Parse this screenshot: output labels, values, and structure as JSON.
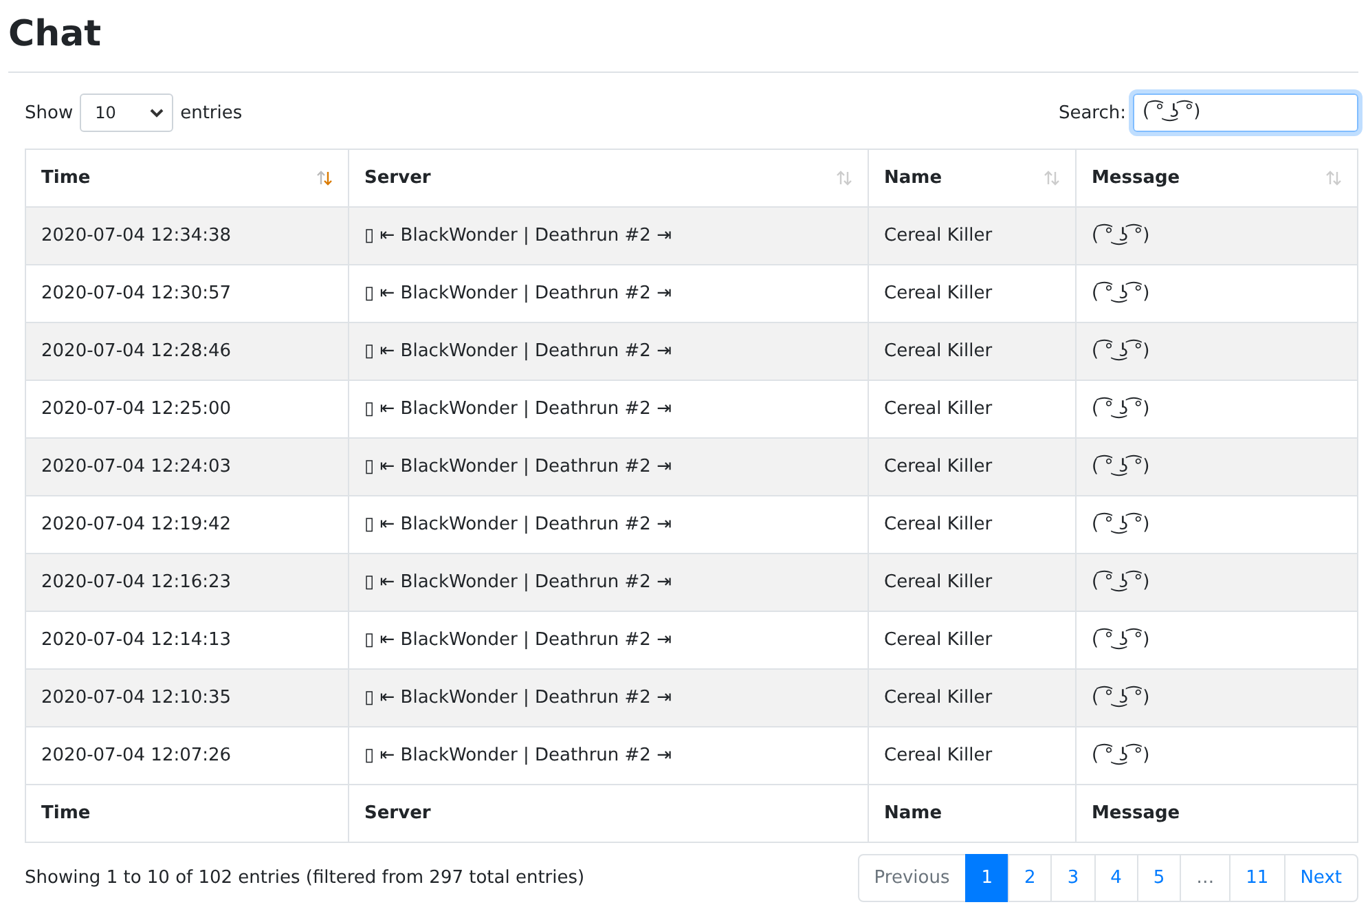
{
  "page": {
    "title": "Chat"
  },
  "length_control": {
    "prefix": "Show",
    "value": "10",
    "suffix": "entries"
  },
  "search": {
    "label": "Search:",
    "value": "( ͡° ͜ʖ ͡°)"
  },
  "table": {
    "columns": [
      {
        "label": "Time",
        "sorted": true
      },
      {
        "label": "Server",
        "sorted": false
      },
      {
        "label": "Name",
        "sorted": false
      },
      {
        "label": "Message",
        "sorted": false
      }
    ],
    "rows": [
      [
        "2020-07-04 12:34:38",
        "▯ ⇤ BlackWonder | Deathrun #2 ⇥",
        "Cereal Killer",
        "( ͡° ͜ʖ ͡°)"
      ],
      [
        "2020-07-04 12:30:57",
        "▯ ⇤ BlackWonder | Deathrun #2 ⇥",
        "Cereal Killer",
        "( ͡° ͜ʖ ͡°)"
      ],
      [
        "2020-07-04 12:28:46",
        "▯ ⇤ BlackWonder | Deathrun #2 ⇥",
        "Cereal Killer",
        "( ͡° ͜ʖ ͡°)"
      ],
      [
        "2020-07-04 12:25:00",
        "▯ ⇤ BlackWonder | Deathrun #2 ⇥",
        "Cereal Killer",
        "( ͡° ͜ʖ ͡°)"
      ],
      [
        "2020-07-04 12:24:03",
        "▯ ⇤ BlackWonder | Deathrun #2 ⇥",
        "Cereal Killer",
        "( ͡° ͜ʖ ͡°)"
      ],
      [
        "2020-07-04 12:19:42",
        "▯ ⇤ BlackWonder | Deathrun #2 ⇥",
        "Cereal Killer",
        "( ͡° ͜ʖ ͡°)"
      ],
      [
        "2020-07-04 12:16:23",
        "▯ ⇤ BlackWonder | Deathrun #2 ⇥",
        "Cereal Killer",
        "( ͡° ͜ʖ ͡°)"
      ],
      [
        "2020-07-04 12:14:13",
        "▯ ⇤ BlackWonder | Deathrun #2 ⇥",
        "Cereal Killer",
        "( ͡° ͜ʖ ͡°)"
      ],
      [
        "2020-07-04 12:10:35",
        "▯ ⇤ BlackWonder | Deathrun #2 ⇥",
        "Cereal Killer",
        "( ͡° ͜ʖ ͡°)"
      ],
      [
        "2020-07-04 12:07:26",
        "▯ ⇤ BlackWonder | Deathrun #2 ⇥",
        "Cereal Killer",
        "( ͡° ͜ʖ ͡°)"
      ]
    ],
    "footer": [
      "Time",
      "Server",
      "Name",
      "Message"
    ]
  },
  "info": "Showing 1 to 10 of 102 entries (filtered from 297 total entries)",
  "pagination": [
    {
      "label": "Previous",
      "selected": false,
      "disabled": true
    },
    {
      "label": "1",
      "selected": true,
      "disabled": false
    },
    {
      "label": "2",
      "selected": false,
      "disabled": false
    },
    {
      "label": "3",
      "selected": false,
      "disabled": false
    },
    {
      "label": "4",
      "selected": false,
      "disabled": false
    },
    {
      "label": "5",
      "selected": false,
      "disabled": false
    },
    {
      "label": "…",
      "selected": false,
      "disabled": true
    },
    {
      "label": "11",
      "selected": false,
      "disabled": false
    },
    {
      "label": "Next",
      "selected": false,
      "disabled": false
    }
  ]
}
